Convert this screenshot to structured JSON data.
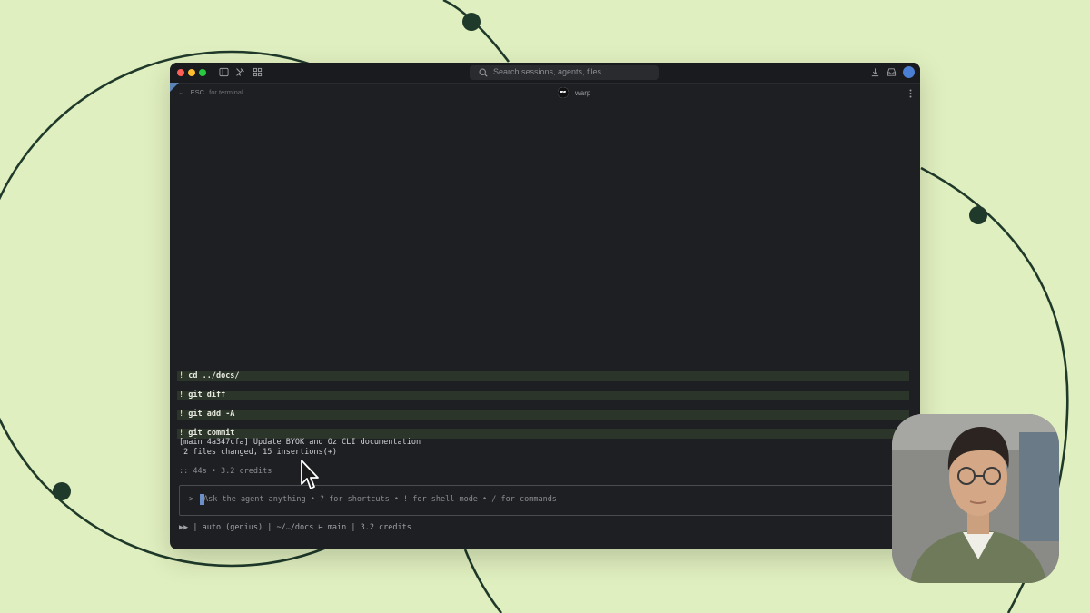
{
  "window": {
    "search_placeholder": "Search sessions, agents, files...",
    "esc_key": "ESC",
    "esc_hint": "for terminal",
    "tab_label": "warp"
  },
  "terminal": {
    "commands": [
      {
        "bang": "!",
        "text": "cd ../docs/"
      },
      {
        "bang": "!",
        "text": "git diff"
      },
      {
        "bang": "!",
        "text": "git add -A"
      },
      {
        "bang": "!",
        "text": "git commit"
      }
    ],
    "output": [
      "[main 4a347cfa] Update BYOK and Oz CLI documentation",
      " 2 files changed, 15 insertions(+)"
    ],
    "stats": ":: 44s • 3.2 credits"
  },
  "prompt": {
    "caret": ">",
    "placeholder": "Ask the agent anything • ? for shortcuts • ! for shell mode • / for commands"
  },
  "statusbar": {
    "text": "▶▶ | auto (genius) | ~/…/docs ⊢ main | 3.2 credits"
  },
  "colors": {
    "background": "#e0efbf",
    "window": "#1e1f23",
    "command_row": "#2c352a",
    "bang": "#ffd35c",
    "cursor": "#6e90c8"
  },
  "icons": [
    "sidebar-toggle-icon",
    "tools-icon",
    "grid-icon",
    "search-icon",
    "download-icon",
    "inbox-icon",
    "avatar",
    "back-arrow-icon",
    "warp-logo",
    "more-icon",
    "mouse-pointer-icon"
  ]
}
